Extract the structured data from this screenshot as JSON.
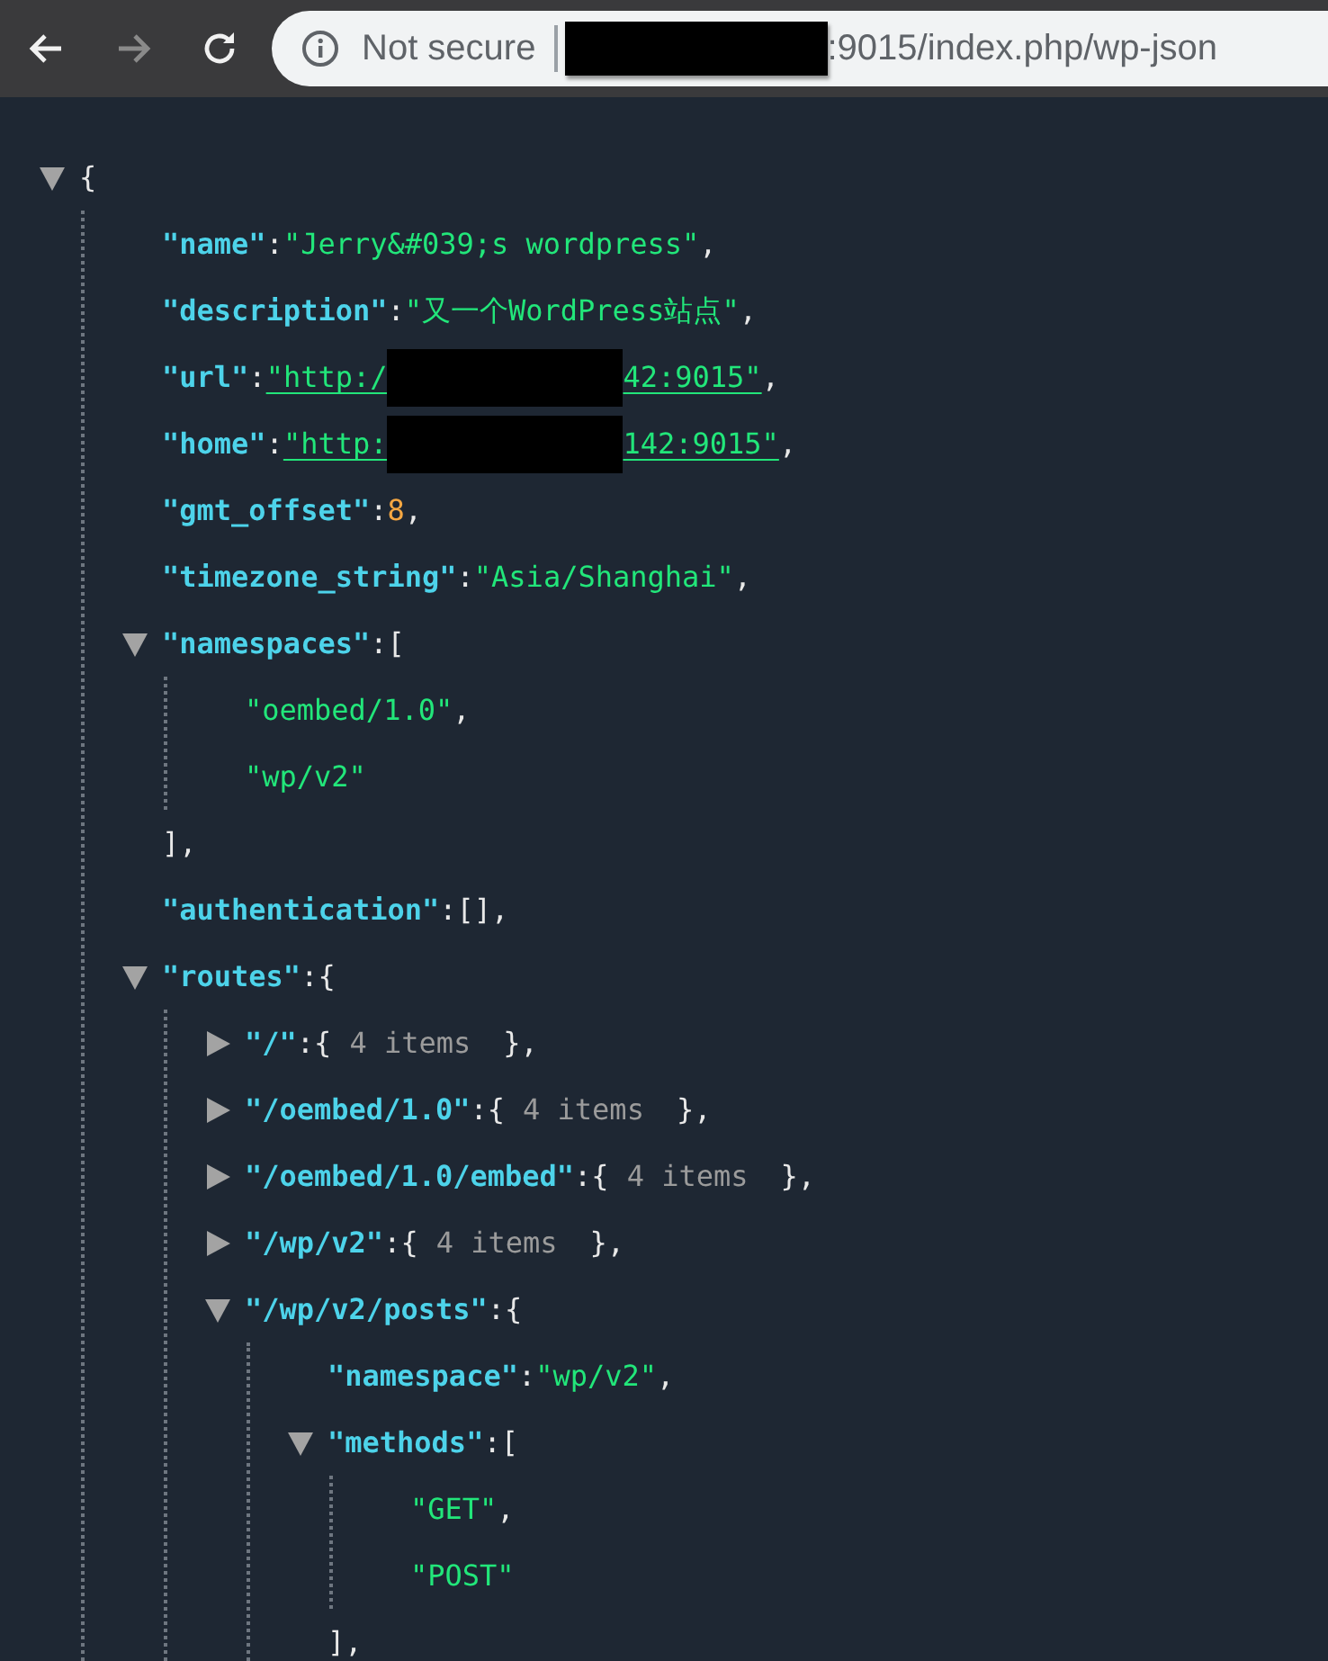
{
  "browser": {
    "nav": [
      {
        "kind": "back",
        "disabled": false
      },
      {
        "kind": "forward",
        "disabled": true
      },
      {
        "kind": "reload",
        "disabled": false
      }
    ],
    "address": {
      "security": "Not secure",
      "url_parts": [
        {
          "kind": "redacted"
        },
        {
          "kind": "text",
          "text": ":9015/index.php/wp-json"
        }
      ]
    }
  },
  "viewer": {
    "root": {
      "expanded": true,
      "tokens": [
        {
          "kind": "punct",
          "text": "{"
        }
      ],
      "children": [
        {
          "tokens": [
            {
              "kind": "key",
              "text": "\"name\""
            },
            {
              "kind": "punct",
              "text": ": "
            },
            {
              "kind": "string",
              "text": "\"Jerry&#039;s wordpress\""
            },
            {
              "kind": "punct",
              "text": ","
            }
          ]
        },
        {
          "tokens": [
            {
              "kind": "key",
              "text": "\"description\""
            },
            {
              "kind": "punct",
              "text": ": "
            },
            {
              "kind": "string",
              "text": "\"又一个WordPress站点\""
            },
            {
              "kind": "punct",
              "text": ","
            }
          ]
        },
        {
          "tokens": [
            {
              "kind": "key",
              "text": "\"url\""
            },
            {
              "kind": "punct",
              "text": ": "
            },
            {
              "kind": "link",
              "text": "\"http:/"
            },
            {
              "kind": "redacted"
            },
            {
              "kind": "link",
              "text": "42:9015\""
            },
            {
              "kind": "punct",
              "text": ","
            }
          ]
        },
        {
          "tokens": [
            {
              "kind": "key",
              "text": "\"home\""
            },
            {
              "kind": "punct",
              "text": ": "
            },
            {
              "kind": "link",
              "text": "\"http:"
            },
            {
              "kind": "redacted"
            },
            {
              "kind": "link",
              "text": "142:9015\""
            },
            {
              "kind": "punct",
              "text": ","
            }
          ]
        },
        {
          "tokens": [
            {
              "kind": "key",
              "text": "\"gmt_offset\""
            },
            {
              "kind": "punct",
              "text": ": "
            },
            {
              "kind": "number",
              "text": "8"
            },
            {
              "kind": "punct",
              "text": ","
            }
          ]
        },
        {
          "tokens": [
            {
              "kind": "key",
              "text": "\"timezone_string\""
            },
            {
              "kind": "punct",
              "text": ": "
            },
            {
              "kind": "string",
              "text": "\"Asia/Shanghai\""
            },
            {
              "kind": "punct",
              "text": ","
            }
          ]
        },
        {
          "expanded": true,
          "tokens": [
            {
              "kind": "key",
              "text": "\"namespaces\""
            },
            {
              "kind": "punct",
              "text": ": "
            },
            {
              "kind": "punct",
              "text": "["
            }
          ],
          "children": [
            {
              "tokens": [
                {
                  "kind": "string",
                  "text": "\"oembed/1.0\""
                },
                {
                  "kind": "punct",
                  "text": ","
                }
              ]
            },
            {
              "tokens": [
                {
                  "kind": "string",
                  "text": "\"wp/v2\""
                }
              ]
            }
          ],
          "close": [
            {
              "kind": "punct",
              "text": "],"
            }
          ]
        },
        {
          "tokens": [
            {
              "kind": "key",
              "text": "\"authentication\""
            },
            {
              "kind": "punct",
              "text": ": "
            },
            {
              "kind": "punct",
              "text": "[]"
            },
            {
              "kind": "punct",
              "text": ","
            }
          ]
        },
        {
          "expanded": true,
          "tokens": [
            {
              "kind": "key",
              "text": "\"routes\""
            },
            {
              "kind": "punct",
              "text": ": "
            },
            {
              "kind": "punct",
              "text": "{"
            }
          ],
          "children": [
            {
              "expanded": false,
              "tokens": [
                {
                  "kind": "key",
                  "text": "\"/\""
                },
                {
                  "kind": "punct",
                  "text": ": "
                },
                {
                  "kind": "punct",
                  "text": "{"
                },
                {
                  "kind": "count",
                  "text": "4 items"
                },
                {
                  "kind": "punct",
                  "text": "},"
                }
              ]
            },
            {
              "expanded": false,
              "tokens": [
                {
                  "kind": "key",
                  "text": "\"/oembed/1.0\""
                },
                {
                  "kind": "punct",
                  "text": ": "
                },
                {
                  "kind": "punct",
                  "text": "{"
                },
                {
                  "kind": "count",
                  "text": "4 items"
                },
                {
                  "kind": "punct",
                  "text": "},"
                }
              ]
            },
            {
              "expanded": false,
              "tokens": [
                {
                  "kind": "key",
                  "text": "\"/oembed/1.0/embed\""
                },
                {
                  "kind": "punct",
                  "text": ": "
                },
                {
                  "kind": "punct",
                  "text": "{"
                },
                {
                  "kind": "count",
                  "text": "4 items"
                },
                {
                  "kind": "punct",
                  "text": "},"
                }
              ]
            },
            {
              "expanded": false,
              "tokens": [
                {
                  "kind": "key",
                  "text": "\"/wp/v2\""
                },
                {
                  "kind": "punct",
                  "text": ": "
                },
                {
                  "kind": "punct",
                  "text": "{"
                },
                {
                  "kind": "count",
                  "text": "4 items"
                },
                {
                  "kind": "punct",
                  "text": "},"
                }
              ]
            },
            {
              "expanded": true,
              "tokens": [
                {
                  "kind": "key",
                  "text": "\"/wp/v2/posts\""
                },
                {
                  "kind": "punct",
                  "text": ": "
                },
                {
                  "kind": "punct",
                  "text": "{"
                }
              ],
              "children": [
                {
                  "tokens": [
                    {
                      "kind": "key",
                      "text": "\"namespace\""
                    },
                    {
                      "kind": "punct",
                      "text": ": "
                    },
                    {
                      "kind": "string",
                      "text": "\"wp/v2\""
                    },
                    {
                      "kind": "punct",
                      "text": ","
                    }
                  ]
                },
                {
                  "expanded": true,
                  "tokens": [
                    {
                      "kind": "key",
                      "text": "\"methods\""
                    },
                    {
                      "kind": "punct",
                      "text": ": "
                    },
                    {
                      "kind": "punct",
                      "text": "["
                    }
                  ],
                  "children": [
                    {
                      "tokens": [
                        {
                          "kind": "string",
                          "text": "\"GET\""
                        },
                        {
                          "kind": "punct",
                          "text": ","
                        }
                      ]
                    },
                    {
                      "tokens": [
                        {
                          "kind": "string",
                          "text": "\"POST\""
                        }
                      ]
                    }
                  ],
                  "close": [
                    {
                      "kind": "punct",
                      "text": "],"
                    }
                  ]
                }
              ]
            }
          ]
        }
      ]
    }
  }
}
